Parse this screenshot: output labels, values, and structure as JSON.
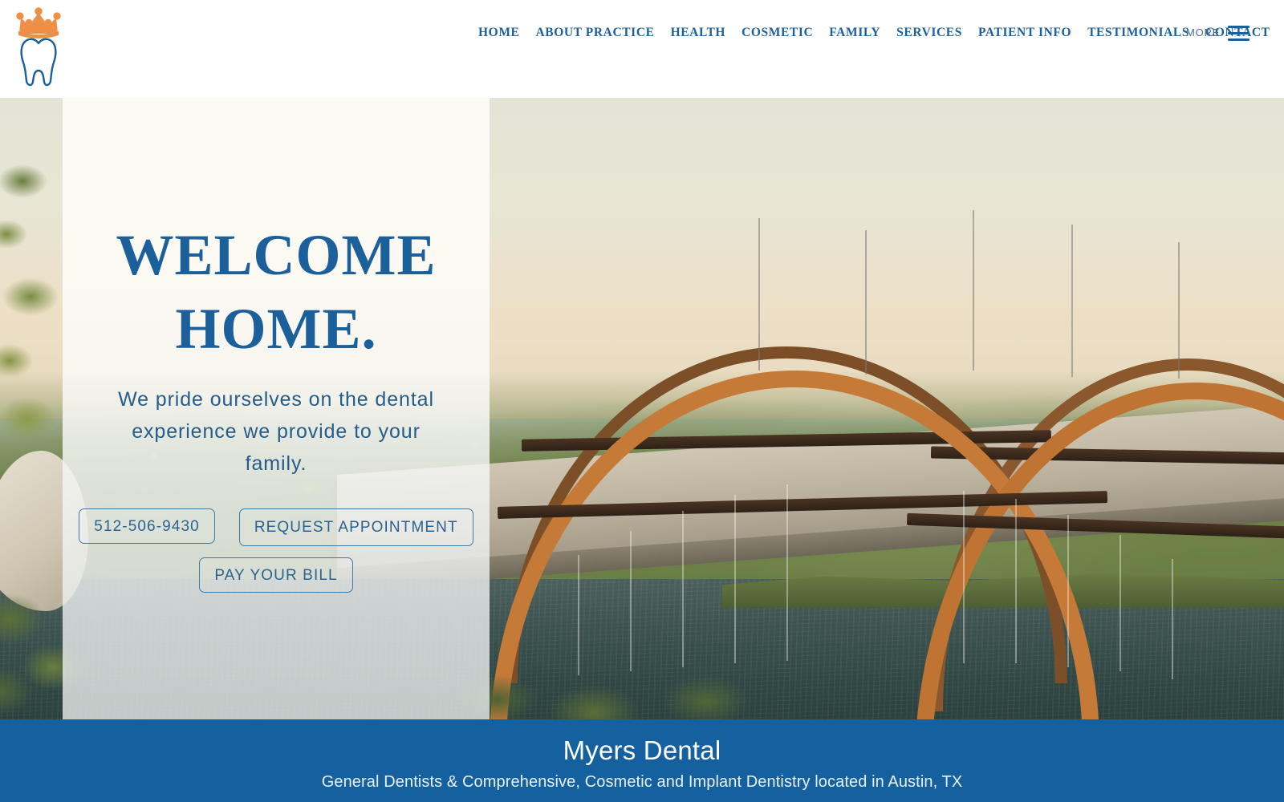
{
  "header": {
    "logo": {
      "name": "myers-dental-tooth-crown-logo",
      "crown_color": "#ef8f45",
      "tooth_color": "#1b5f9b"
    },
    "nav_items": [
      {
        "label": "HOME"
      },
      {
        "label": "ABOUT PRACTICE"
      },
      {
        "label": "HEALTH"
      },
      {
        "label": "COSMETIC"
      },
      {
        "label": "FAMILY"
      },
      {
        "label": "SERVICES"
      },
      {
        "label": "PATIENT INFO"
      },
      {
        "label": "TESTIMONIALS"
      },
      {
        "label": "CONTACT"
      }
    ],
    "more_label": "MORE",
    "menu_icon": "hamburger-menu-icon",
    "nav_color": "#1b5f9b"
  },
  "hero": {
    "title_line1": "WELCOME",
    "title_line2": "HOME.",
    "subtitle": "We pride ourselves on the dental experience we provide to your family.",
    "title_color": "#1b5f9b",
    "buttons": [
      {
        "label": "512-506-9430",
        "name": "phone-button"
      },
      {
        "label": "REQUEST APPOINTMENT",
        "name": "request-appointment-button"
      },
      {
        "label": "PAY YOUR BILL",
        "name": "pay-your-bill-button"
      }
    ],
    "background_image": "pennybacker-360-bridge-austin-texas-photo"
  },
  "banner": {
    "title": "Myers Dental",
    "subtitle": "General Dentists & Comprehensive, Cosmetic and Implant Dentistry located in Austin, TX",
    "background_color": "#15609e"
  }
}
